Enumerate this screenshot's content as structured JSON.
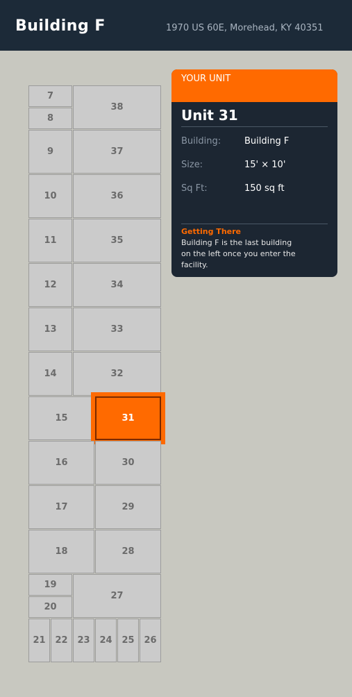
{
  "header": {
    "title": "Building F",
    "address": "1970 US 60E, Morehead, KY 40351"
  },
  "colors": {
    "header_bg": "#1c2a38",
    "accent": "#ff6a00",
    "unit_fill": "#cbcbcb",
    "page_bg": "#c8c8c0"
  },
  "site_map": {
    "selected_unit": "31",
    "units": [
      "7",
      "8",
      "38",
      "9",
      "37",
      "10",
      "36",
      "11",
      "35",
      "12",
      "34",
      "13",
      "33",
      "14",
      "32",
      "15",
      "31",
      "16",
      "30",
      "17",
      "29",
      "18",
      "28",
      "19",
      "20",
      "27",
      "21",
      "22",
      "23",
      "24",
      "25",
      "26"
    ]
  },
  "card": {
    "header_label": "YOUR UNIT",
    "unit_title": "Unit 31",
    "building_label": "Building:",
    "building_value": "Building F",
    "size_label": "Size:",
    "size_value": "15' × 10'",
    "sqft_label": "Sq Ft:",
    "sqft_value": "150 sq ft",
    "getting_there_title": "Getting There",
    "getting_there_text": "Building F is the last building on the left once you enter the facility."
  }
}
